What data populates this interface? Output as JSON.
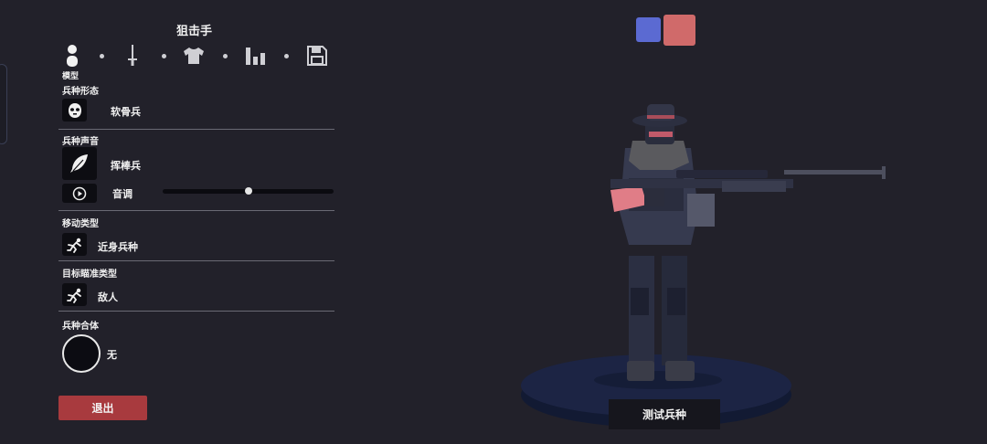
{
  "unit": {
    "name": "狙击手"
  },
  "tabs": {
    "active_label": "模型",
    "items": [
      {
        "name": "model",
        "icon": "person-icon"
      },
      {
        "name": "weapon",
        "icon": "sword-icon"
      },
      {
        "name": "clothing",
        "icon": "shirt-icon"
      },
      {
        "name": "stats",
        "icon": "bar-chart-icon"
      },
      {
        "name": "save",
        "icon": "save-icon"
      }
    ]
  },
  "sections": {
    "form": {
      "label": "兵种形态",
      "value": "软骨兵"
    },
    "voice": {
      "label": "兵种声音",
      "value": "挥棒兵",
      "pitch_label": "音调",
      "pitch_level": 0.5
    },
    "movement": {
      "label": "移动类型",
      "value": "近身兵种"
    },
    "targeting": {
      "label": "目标瞄准类型",
      "value": "敌人"
    },
    "fusion": {
      "label": "兵种合体",
      "value": "无"
    }
  },
  "buttons": {
    "exit": "退出",
    "test": "测试兵种"
  },
  "colors": {
    "team_blue": "#5b6ad2",
    "team_red": "#d06a6a",
    "exit_button": "#a83a3e",
    "background": "#22212a"
  }
}
